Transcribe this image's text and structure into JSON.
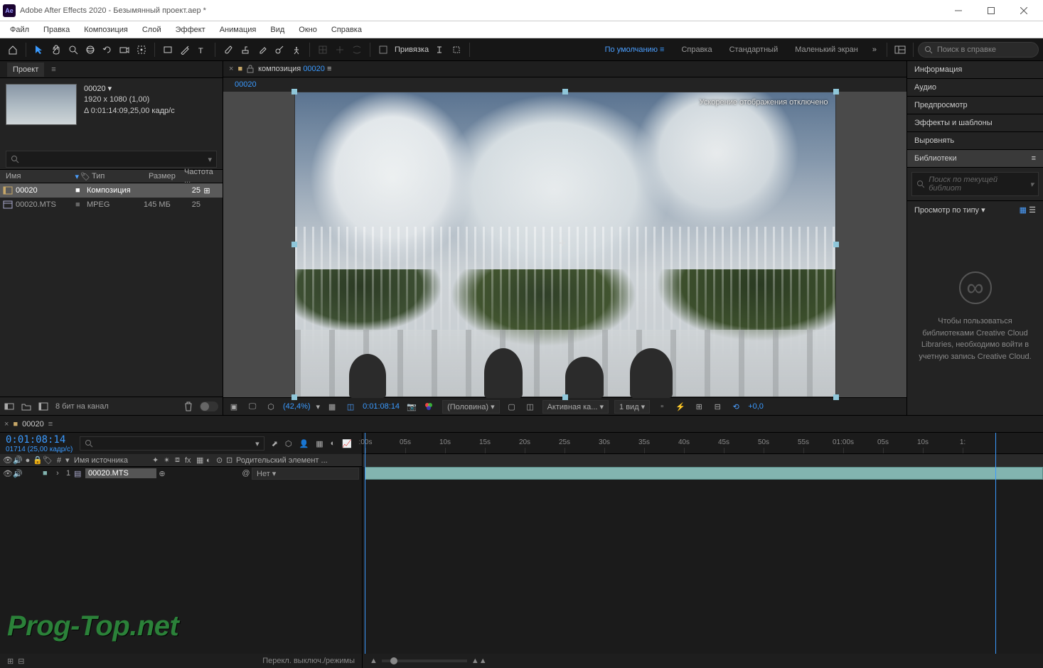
{
  "titlebar": {
    "logo_text": "Ae",
    "title": "Adobe After Effects 2020 - Безымянный проект.aep *"
  },
  "menubar": [
    "Файл",
    "Правка",
    "Композиция",
    "Слой",
    "Эффект",
    "Анимация",
    "Вид",
    "Окно",
    "Справка"
  ],
  "toolbar": {
    "snap_label": "Привязка",
    "workspaces": [
      "По умолчанию",
      "Справка",
      "Стандартный",
      "Маленький экран"
    ],
    "search_placeholder": "Поиск в справке"
  },
  "project": {
    "panel_label": "Проект",
    "item_name": "00020",
    "item_dims": "1920 x 1080 (1,00)",
    "item_dur": "Δ 0:01:14:09,25,00 кадр/с",
    "cols": {
      "name": "Имя",
      "type": "Тип",
      "size": "Размер",
      "freq": "Частота ..."
    },
    "rows": [
      {
        "name": "00020",
        "type": "Композиция",
        "size": "",
        "freq": "25"
      },
      {
        "name": "00020.MTS",
        "type": "MPEG",
        "size": "145 МБ",
        "freq": "25"
      }
    ],
    "footer_bpc": "8 бит на канал"
  },
  "comp": {
    "tab_label": "композиция",
    "tab_name": "00020",
    "breadcrumb": "00020",
    "overlay_msg": "Ускорение отображения отключено",
    "footer": {
      "zoom": "(42,4%)",
      "time": "0:01:08:14",
      "resolution": "(Половина)",
      "camera": "Активная ка...",
      "views": "1 вид",
      "exposure": "+0,0"
    }
  },
  "right": {
    "sections": [
      "Информация",
      "Аудио",
      "Предпросмотр",
      "Эффекты и шаблоны",
      "Выровнять",
      "Библиотеки"
    ],
    "lib_search_placeholder": "Поиск по текущей библиот",
    "view_by": "Просмотр по типу",
    "cc_text": "Чтобы пользоваться библиотеками Creative Cloud Libraries, необходимо войти в учетную запись Creative Cloud."
  },
  "timeline": {
    "tab_name": "00020",
    "time": "0:01:08:14",
    "frame": "01714 (25,00 кадр/с)",
    "cols": {
      "source": "Имя источника",
      "parent": "Родительский элемент ..."
    },
    "layer": {
      "index": "1",
      "name": "00020.MTS",
      "parent_val": "Нет"
    },
    "ruler_labels": [
      ":00s",
      "05s",
      "10s",
      "15s",
      "20s",
      "25s",
      "30s",
      "35s",
      "40s",
      "45s",
      "50s",
      "55s",
      "01:00s",
      "05s",
      "10s",
      "1:"
    ],
    "footer_label": "Перекл. выключ./режимы"
  },
  "watermark": "Prog-Top.net"
}
